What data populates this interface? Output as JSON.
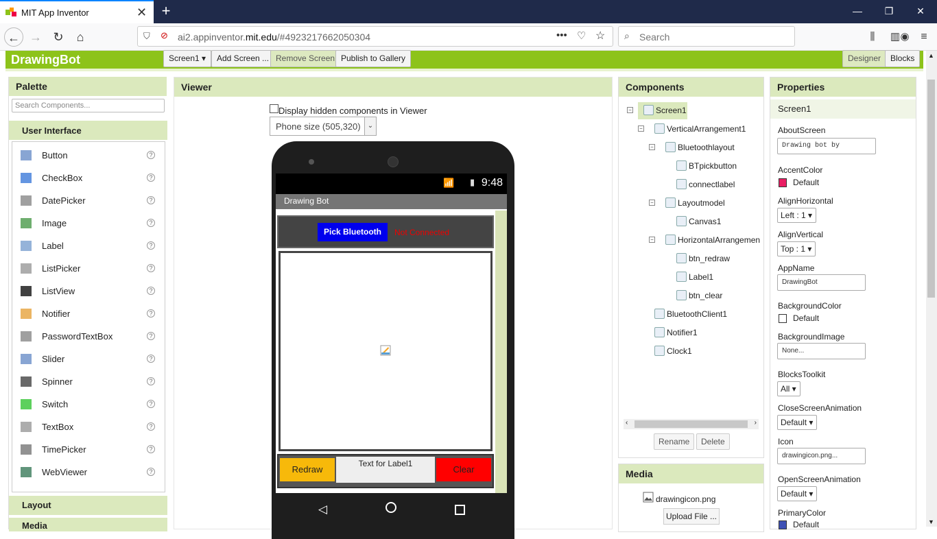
{
  "browser": {
    "tab_title": "MIT App Inventor",
    "url_prefix": "ai2.appinventor.",
    "url_domain": "mit.edu",
    "url_path": "/#4923217662050304",
    "search_placeholder": "Search"
  },
  "app": {
    "name": "DrawingBot",
    "screen_select": "Screen1 ▾",
    "add_screen": "Add Screen ...",
    "remove_screen": "Remove Screen",
    "publish": "Publish to Gallery",
    "designer": "Designer",
    "blocks": "Blocks"
  },
  "palette": {
    "title": "Palette",
    "search_placeholder": "Search Components...",
    "section": "User Interface",
    "items": [
      "Button",
      "CheckBox",
      "DatePicker",
      "Image",
      "Label",
      "ListPicker",
      "ListView",
      "Notifier",
      "PasswordTextBox",
      "Slider",
      "Spinner",
      "Switch",
      "TextBox",
      "TimePicker",
      "WebViewer"
    ],
    "layout_section": "Layout",
    "media_section": "Media"
  },
  "viewer": {
    "title": "Viewer",
    "hidden_label": "Display hidden components in Viewer",
    "phone_size": "Phone size (505,320)",
    "time": "9:48",
    "screen_title": "Drawing Bot",
    "pick_bluetooth": "Pick Bluetooth",
    "not_connected": "Not Connected",
    "redraw": "Redraw",
    "label1": "Text for Label1",
    "clear": "Clear"
  },
  "components": {
    "title": "Components",
    "tree": [
      {
        "label": "Screen1",
        "indent": 0,
        "toggle": "⊟"
      },
      {
        "label": "VerticalArrangement1",
        "indent": 1,
        "toggle": "⊟"
      },
      {
        "label": "Bluetoothlayout",
        "indent": 2,
        "toggle": "⊟"
      },
      {
        "label": "BTpickbutton",
        "indent": 3,
        "toggle": ""
      },
      {
        "label": "connectlabel",
        "indent": 3,
        "toggle": ""
      },
      {
        "label": "Layoutmodel",
        "indent": 2,
        "toggle": "⊟"
      },
      {
        "label": "Canvas1",
        "indent": 3,
        "toggle": ""
      },
      {
        "label": "HorizontalArrangemen",
        "indent": 2,
        "toggle": "⊟"
      },
      {
        "label": "btn_redraw",
        "indent": 3,
        "toggle": ""
      },
      {
        "label": "Label1",
        "indent": 3,
        "toggle": ""
      },
      {
        "label": "btn_clear",
        "indent": 3,
        "toggle": ""
      },
      {
        "label": "BluetoothClient1",
        "indent": 1,
        "toggle": ""
      },
      {
        "label": "Notifier1",
        "indent": 1,
        "toggle": ""
      },
      {
        "label": "Clock1",
        "indent": 1,
        "toggle": ""
      }
    ],
    "rename": "Rename",
    "delete": "Delete"
  },
  "media": {
    "title": "Media",
    "file": "drawingicon.png",
    "upload": "Upload File ..."
  },
  "properties": {
    "title": "Properties",
    "component": "Screen1",
    "about_label": "AboutScreen",
    "about_value": "Drawing bot by",
    "accent_label": "AccentColor",
    "accent_value": "Default",
    "accent_color": "#e91e63",
    "alignh_label": "AlignHorizontal",
    "alignh_value": "Left : 1 ▾",
    "alignv_label": "AlignVertical",
    "alignv_value": "Top : 1 ▾",
    "appname_label": "AppName",
    "appname_value": "DrawingBot",
    "bgcolor_label": "BackgroundColor",
    "bgcolor_value": "Default",
    "bgimage_label": "BackgroundImage",
    "bgimage_value": "None...",
    "toolkit_label": "BlocksToolkit",
    "toolkit_value": "All ▾",
    "closeanim_label": "CloseScreenAnimation",
    "closeanim_value": "Default ▾",
    "icon_label": "Icon",
    "icon_value": "drawingicon.png...",
    "openanim_label": "OpenScreenAnimation",
    "openanim_value": "Default ▾",
    "primary_label": "PrimaryColor",
    "primary_value": "Default"
  }
}
